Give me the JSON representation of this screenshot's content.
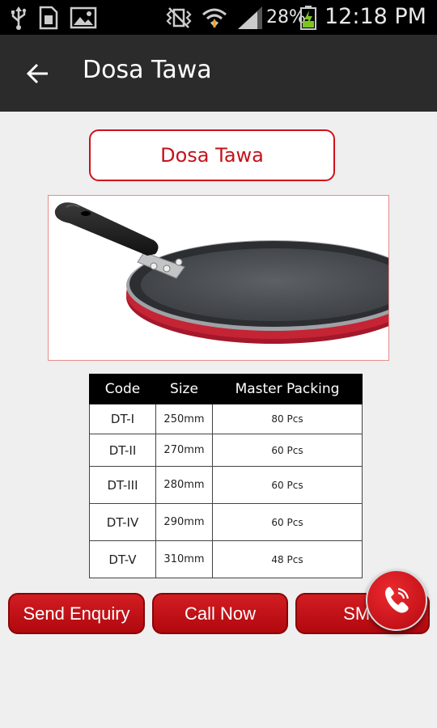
{
  "status_bar": {
    "battery": "28%",
    "time": "12:18 PM",
    "icons": [
      "usb-icon",
      "sim-icon",
      "image-icon",
      "vibrate-icon",
      "wifi-icon",
      "signal-icon",
      "battery-icon"
    ]
  },
  "action_bar": {
    "title": "Dosa Tawa",
    "back_icon": "back-arrow-icon"
  },
  "product": {
    "title": "Dosa Tawa",
    "image": "dosa-tawa-pan-image"
  },
  "table": {
    "headers": [
      "Code",
      "Size",
      "Master Packing"
    ],
    "rows": [
      [
        "DT-I",
        "250mm",
        "80 Pcs"
      ],
      [
        "DT-II",
        "270mm",
        "60 Pcs"
      ],
      [
        "DT-III",
        "280mm",
        "60 Pcs"
      ],
      [
        "DT-IV",
        "290mm",
        "60 Pcs"
      ],
      [
        "DT-V",
        "310mm",
        "48 Pcs"
      ]
    ]
  },
  "buttons": {
    "send_enquiry": "Send Enquiry",
    "call_now": "Call Now",
    "sms": "SMS"
  },
  "fab": {
    "icon": "phone-icon"
  },
  "colors": {
    "accent": "#c5121b",
    "action_bar": "#2b2b2b",
    "background": "#efefef"
  }
}
